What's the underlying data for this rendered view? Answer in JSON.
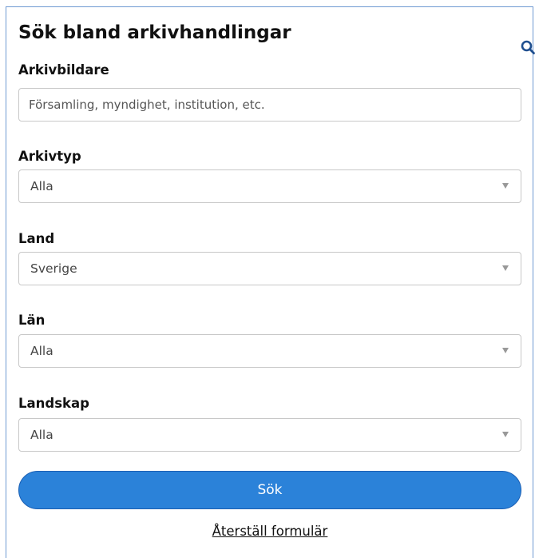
{
  "form": {
    "title": "Sök bland arkivhandlingar",
    "search_icon": "search-icon",
    "arkivbildare": {
      "label": "Arkivbildare",
      "value": "",
      "placeholder": "Församling, myndighet, institution, etc."
    },
    "arkivtyp": {
      "label": "Arkivtyp",
      "selected": "Alla"
    },
    "land": {
      "label": "Land",
      "selected": "Sverige"
    },
    "lan": {
      "label": "Län",
      "selected": "Alla"
    },
    "landskap": {
      "label": "Landskap",
      "selected": "Alla"
    },
    "submit_label": "Sök",
    "reset_label": "Återställ formulär"
  },
  "colors": {
    "button_bg": "#2b82d9",
    "button_border": "#1a5fb4",
    "frame_border": "#6f9ad2",
    "search_icon": "#1f4f8f"
  }
}
